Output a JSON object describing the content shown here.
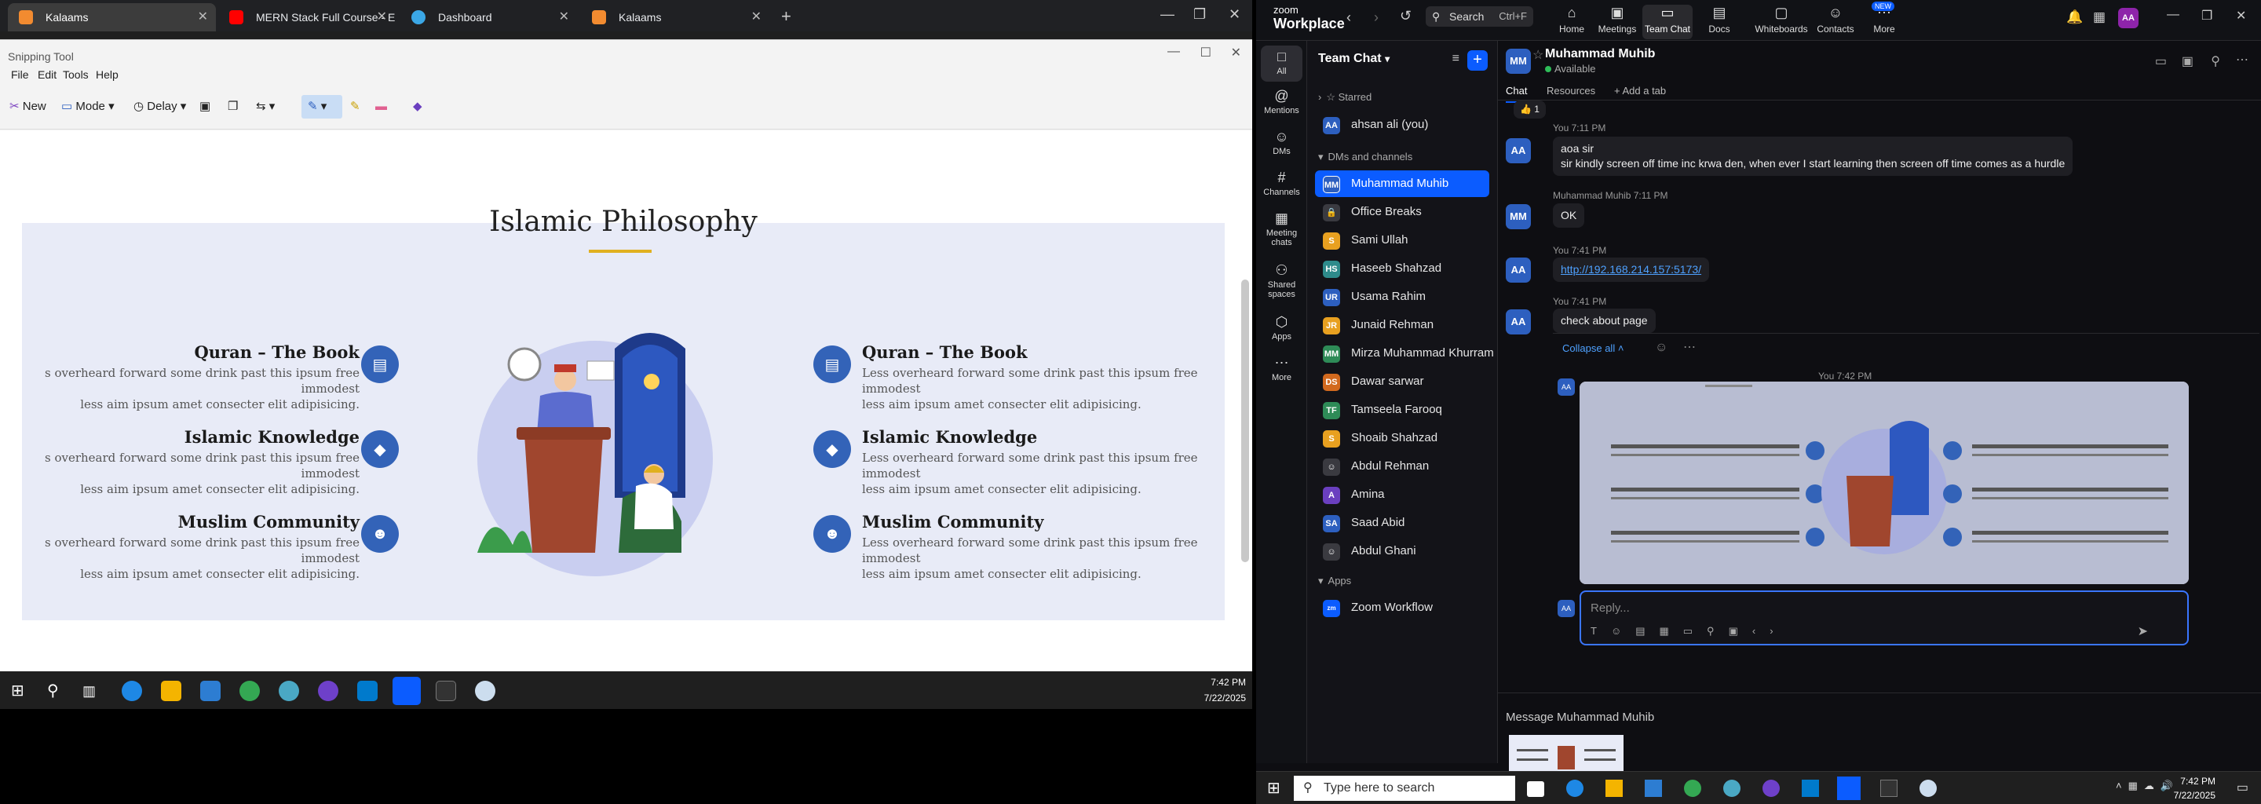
{
  "left_monitor": {
    "browser_tabs": [
      {
        "title": "Kalaams",
        "color": "#f28b30"
      },
      {
        "title": "MERN Stack Full Course - ECom",
        "color": "#ff0000"
      },
      {
        "title": "Dashboard",
        "color": "#3ba7e6"
      },
      {
        "title": "Kalaams",
        "color": "#f28b30"
      }
    ],
    "snipping_tool": {
      "title": "Snipping Tool",
      "menu": [
        "File",
        "Edit",
        "Tools",
        "Help"
      ],
      "toolbar": {
        "new": "New",
        "mode": "Mode",
        "delay": "Delay"
      },
      "slide": {
        "title": "Islamic Philosophy",
        "topics_left": [
          {
            "heading": "Quran – The Book",
            "line1": "s overheard forward some drink past this ipsum free immodest",
            "line2": "less aim ipsum amet consecter elit adipisicing."
          },
          {
            "heading": "Islamic Knowledge",
            "line1": "s overheard forward some drink past this ipsum free immodest",
            "line2": "less aim ipsum amet consecter elit adipisicing."
          },
          {
            "heading": "Muslim Community",
            "line1": "s overheard forward some drink past this ipsum free immodest",
            "line2": "less aim ipsum amet consecter elit adipisicing."
          }
        ],
        "topics_right": [
          {
            "heading": "Quran – The Book",
            "line1": "Less overheard forward some drink past this ipsum free immodest",
            "line2": "less aim ipsum amet consecter elit adipisicing."
          },
          {
            "heading": "Islamic Knowledge",
            "line1": "Less overheard forward some drink past this ipsum free immodest",
            "line2": "less aim ipsum amet consecter elit adipisicing."
          },
          {
            "heading": "Muslim Community",
            "line1": "Less overheard forward some drink past this ipsum free immodest",
            "line2": "less aim ipsum amet consecter elit adipisicing."
          }
        ]
      }
    },
    "clock": {
      "time": "7:42 PM",
      "date": "7/22/2025"
    }
  },
  "zoom": {
    "brand_top": "zoom",
    "brand_bottom": "Workplace",
    "search": {
      "label": "Search",
      "shortcut": "Ctrl+F"
    },
    "nav": [
      {
        "label": "Home",
        "glyph": "⌂"
      },
      {
        "label": "Meetings",
        "glyph": "▣"
      },
      {
        "label": "Team Chat",
        "glyph": "▭"
      },
      {
        "label": "Docs",
        "glyph": "▤"
      },
      {
        "label": "Whiteboards",
        "glyph": "▢"
      },
      {
        "label": "Contacts",
        "glyph": "☺"
      },
      {
        "label": "More",
        "glyph": "⋯"
      }
    ],
    "nav_badge": "NEW",
    "user_avatar": "AA",
    "rail": [
      {
        "label": "All",
        "glyph": "□"
      },
      {
        "label": "Mentions",
        "glyph": "@"
      },
      {
        "label": "DMs",
        "glyph": "☺"
      },
      {
        "label": "Channels",
        "glyph": "#"
      },
      {
        "label": "Meeting chats",
        "glyph": "▦"
      },
      {
        "label": "Shared spaces",
        "glyph": "⚇"
      },
      {
        "label": "Apps",
        "glyph": "⬡"
      },
      {
        "label": "More",
        "glyph": "⋯"
      }
    ],
    "sidebar": {
      "title": "Team Chat",
      "starred": "Starred",
      "dms_and_channels": "DMs and channels",
      "apps": "Apps",
      "items": [
        {
          "name": "ahsan ali (you)",
          "initials": "AA",
          "color": "#2d5fbf"
        },
        {
          "name": "Muhammad Muhib",
          "initials": "MM",
          "color": "#2d5fbf"
        },
        {
          "name": "Office Breaks",
          "initials": "▣",
          "color": "#3a3a40"
        },
        {
          "name": "Sami Ullah",
          "initials": "S",
          "color": "#e8a020"
        },
        {
          "name": "Haseeb Shahzad",
          "initials": "HS",
          "color": "#2e8b8b"
        },
        {
          "name": "Usama Rahim",
          "initials": "UR",
          "color": "#2d5fbf"
        },
        {
          "name": "Junaid Rehman",
          "initials": "JR",
          "color": "#e8a020"
        },
        {
          "name": "Mirza Muhammad Khurram",
          "initials": "MM",
          "color": "#2e8b57"
        },
        {
          "name": "Dawar sarwar",
          "initials": "DS",
          "color": "#d2691e"
        },
        {
          "name": "Tamseela Farooq",
          "initials": "TF",
          "color": "#2e8b57"
        },
        {
          "name": "Shoaib Shahzad",
          "initials": "S",
          "color": "#e8a020"
        },
        {
          "name": "Abdul Rehman",
          "initials": "☺",
          "color": "#3a3a40"
        },
        {
          "name": "Amina",
          "initials": "A",
          "color": "#6a3fbf"
        },
        {
          "name": "Saad Abid",
          "initials": "SA",
          "color": "#2d5fbf"
        },
        {
          "name": "Abdul Ghani",
          "initials": "☺",
          "color": "#3a3a40"
        }
      ],
      "app_item": "Zoom Workflow"
    },
    "chat": {
      "name": "Muhammad Muhib",
      "status": "Available",
      "tabs": [
        "Chat",
        "Resources",
        "+ Add a tab"
      ],
      "messages": [
        {
          "meta": "You 7:11 PM",
          "line1": "aoa sir",
          "line2": "sir kindly screen off time inc krwa den, when ever I start learning then screen off time comes as a hurdle"
        },
        {
          "meta": "Muhammad Muhib 7:11 PM",
          "text": "OK"
        },
        {
          "meta": "You 7:41 PM",
          "text": "http://192.168.214.157:5173/"
        },
        {
          "meta": "You 7:41 PM",
          "text": "check about page"
        }
      ],
      "collapse": "Collapse all",
      "preview_meta": "You 7:42 PM",
      "reply_placeholder": "Reply...",
      "compose_label": "Message Muhammad Muhib",
      "reaction": "👍 1"
    },
    "taskbar": {
      "search": "Type here to search",
      "time": "7:42 PM",
      "date": "7/22/2025"
    }
  }
}
